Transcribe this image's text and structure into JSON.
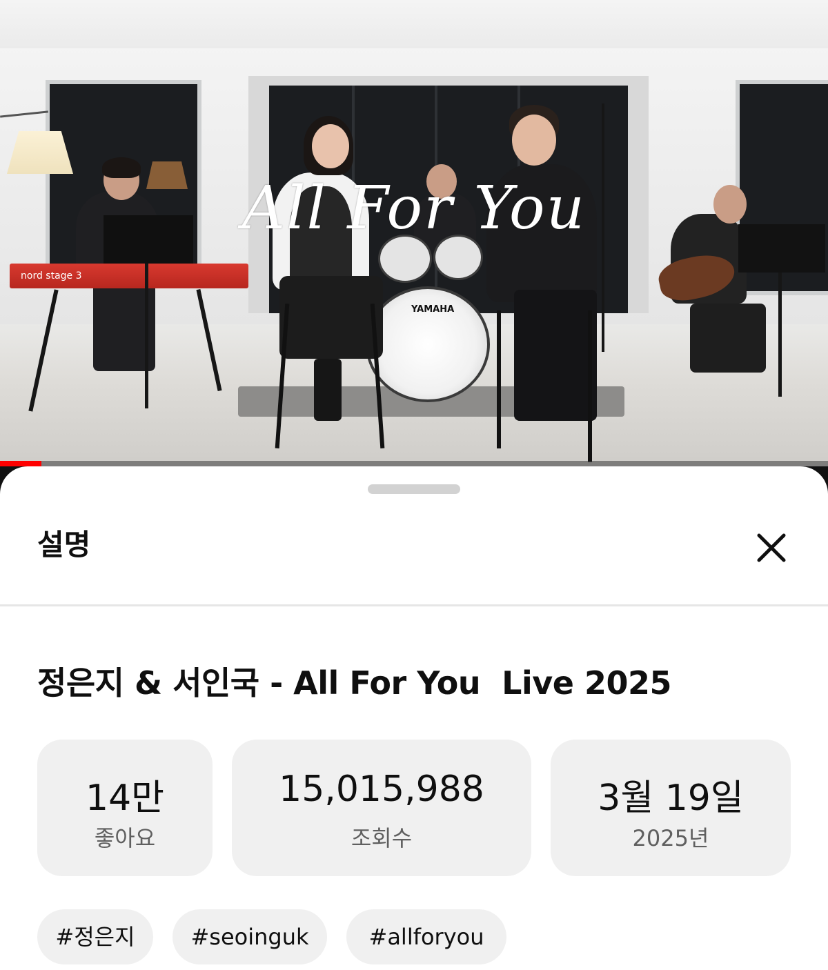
{
  "video": {
    "overlay_title": "All For You",
    "keyboard_brand": "nord stage 3",
    "drum_brand": "YAMAHA",
    "progress_fraction": 0.05
  },
  "sheet": {
    "title": "설명",
    "close_icon": "close-icon",
    "video_title": "정은지 & 서인국 - All For You  Live 2025",
    "stats": {
      "likes": {
        "value": "14만",
        "label": "좋아요"
      },
      "views": {
        "value": "15,015,988",
        "label": "조회수"
      },
      "date": {
        "value": "3월 19일",
        "label": "2025년"
      }
    },
    "tags": [
      "#정은지",
      "#seoinguk",
      "#allforyou"
    ]
  },
  "colors": {
    "progress": "#ff0000",
    "card_bg": "#f0f0f0",
    "text": "#0f0f0f",
    "secondary_text": "#5f5f5f"
  }
}
